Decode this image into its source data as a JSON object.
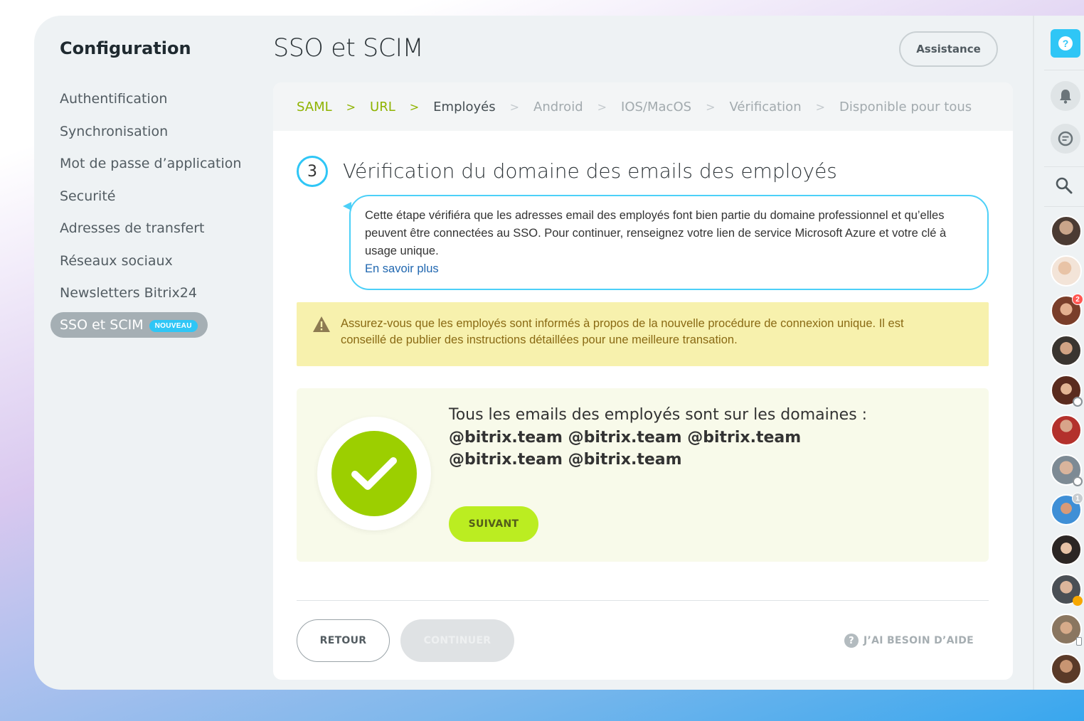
{
  "nav": {
    "title": "Configuration",
    "items": [
      {
        "label": "Authentification"
      },
      {
        "label": "Synchronisation"
      },
      {
        "label": "Mot de passe d’application"
      },
      {
        "label": "Securité"
      },
      {
        "label": "Adresses de transfert"
      },
      {
        "label": "Réseaux sociaux"
      },
      {
        "label": "Newsletters Bitrix24"
      }
    ],
    "active": {
      "label": "SSO et SCIM",
      "badge": "NOUVEAU"
    }
  },
  "header": {
    "title": "SSO et SCIM",
    "assist_label": "Assistance"
  },
  "stepper": {
    "sep": ">",
    "steps": [
      {
        "label": "SAML",
        "state": "done"
      },
      {
        "label": "URL",
        "state": "done"
      },
      {
        "label": "Employés",
        "state": "current"
      },
      {
        "label": "Android",
        "state": "todo"
      },
      {
        "label": "IOS/MacOS",
        "state": "todo"
      },
      {
        "label": "Vérification",
        "state": "todo"
      },
      {
        "label": "Disponible pour tous",
        "state": "todo"
      }
    ]
  },
  "section": {
    "number": "3",
    "title": "Vérification du domaine des emails des employés",
    "info_text": "Cette étape vérifiéra que les adresses email des employés font bien partie du domaine professionnel et qu’elles peuvent être connectées au SSO. Pour continuer, renseignez votre lien de service Microsoft Azure et votre clé à usage unique.",
    "info_link": "En savoir plus",
    "warning": "Assurez-vous que les employés sont informés à propos de la nouvelle procédure de connexion unique. Il est conseillé de publier des instructions détaillées pour une meilleure transation."
  },
  "result": {
    "text": "Tous les emails des employés sont sur les domaines :",
    "domains": "@bitrix.team @bitrix.team @bitrix.team @bitrix.team @bitrix.team",
    "next_label": "SUIVANT"
  },
  "footer": {
    "back_label": "RETOUR",
    "continue_label": "CONTINUER",
    "help_label": "J’AI BESOIN D’AIDE"
  },
  "rail": {
    "help_glyph": "?",
    "badges": [
      "2",
      "1"
    ]
  },
  "colors": {
    "accent": "#2fc6f6",
    "success": "#9ccf00",
    "next_button": "#bbed21",
    "warning_bg": "#f7f1ad"
  },
  "icons": [
    "help-icon",
    "bell-icon",
    "chat-icon",
    "search-icon",
    "warning-icon",
    "check-icon"
  ]
}
